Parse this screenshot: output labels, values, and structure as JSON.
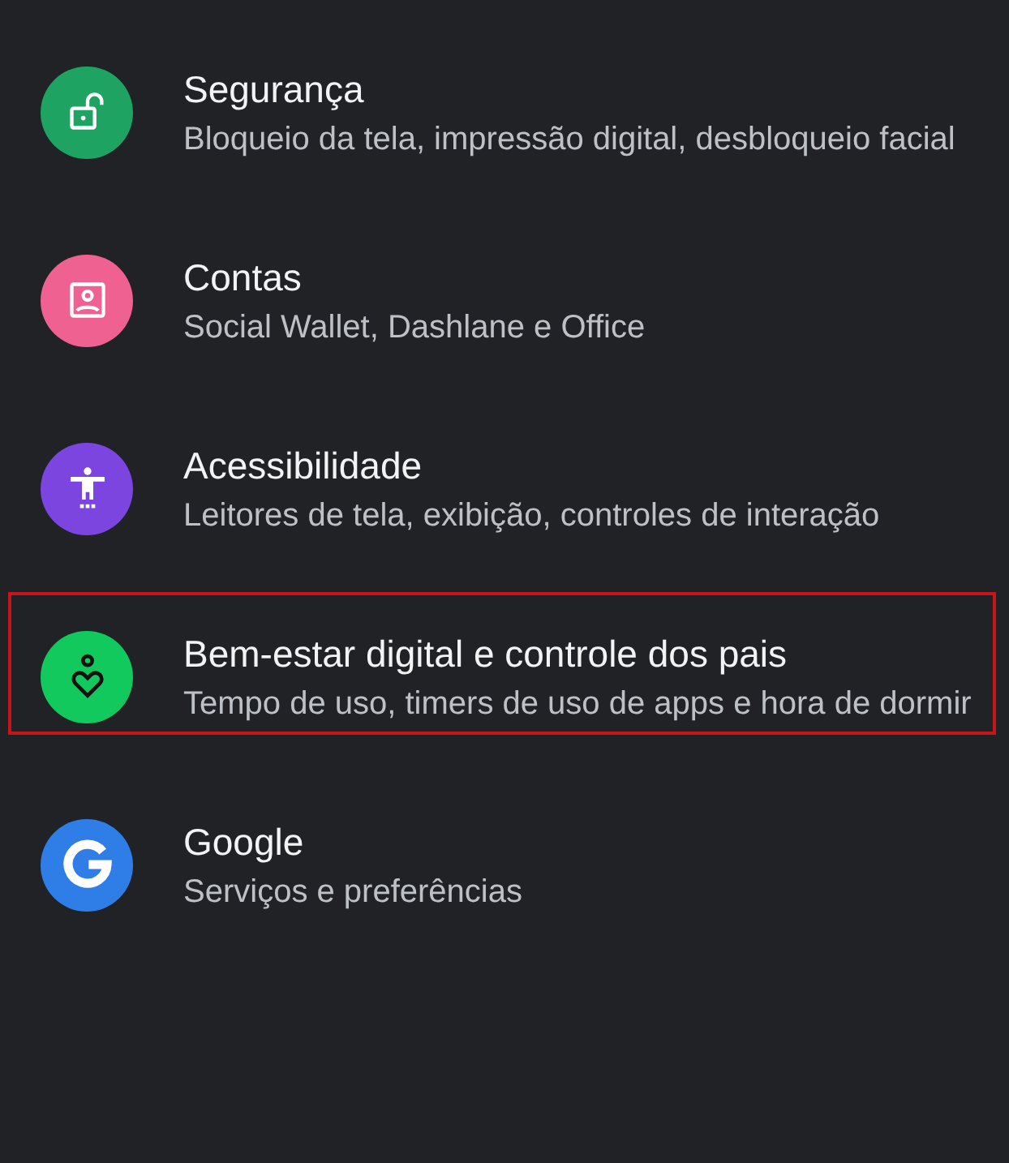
{
  "settings": [
    {
      "kind": "lock",
      "color": "#1ea362",
      "title": "Segurança",
      "subtitle": "Bloqueio da tela, impressão digital, desbloqueio facial",
      "highlighted": false
    },
    {
      "kind": "account",
      "color": "#ef6191",
      "title": "Contas",
      "subtitle": "Social Wallet, Dashlane e Office",
      "highlighted": false
    },
    {
      "kind": "accessibility",
      "color": "#7d45e0",
      "title": "Acessibilidade",
      "subtitle": "Leitores de tela, exibição, controles de interação",
      "highlighted": false
    },
    {
      "kind": "wellbeing",
      "color": "#12c95e",
      "title": "Bem-estar digital e controle dos pais",
      "subtitle": "Tempo de uso, timers de uso de apps e hora de dormir",
      "highlighted": true
    },
    {
      "kind": "google",
      "color": "#2f7ee8",
      "title": "Google",
      "subtitle": "Serviços e preferências",
      "highlighted": false
    }
  ]
}
